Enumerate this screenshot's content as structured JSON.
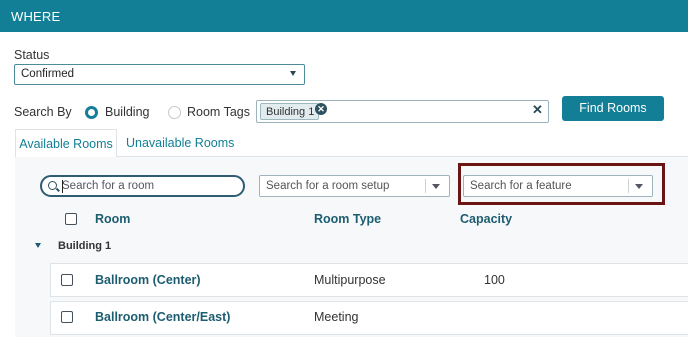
{
  "header": {
    "title": "WHERE"
  },
  "status": {
    "label": "Status",
    "value": "Confirmed"
  },
  "search_by": {
    "label": "Search By",
    "options": [
      "Building",
      "Room Tags"
    ],
    "selected": "Building",
    "tags": [
      "Building 1"
    ]
  },
  "find_button": {
    "label": "Find Rooms"
  },
  "tabs": [
    {
      "label": "Available Rooms",
      "active": true
    },
    {
      "label": "Unavailable Rooms",
      "active": false
    }
  ],
  "filters": {
    "room_search_placeholder": "Search for a room",
    "room_setup_placeholder": "Search for a room setup",
    "feature_placeholder": "Search for a feature"
  },
  "table": {
    "columns": [
      "Room",
      "Room Type",
      "Capacity"
    ],
    "group": {
      "label": "Building 1"
    },
    "rows": [
      {
        "room": "Ballroom (Center)",
        "type": "Multipurpose",
        "capacity": "100"
      },
      {
        "room": "Ballroom (Center/East)",
        "type": "Meeting",
        "capacity": ""
      }
    ]
  },
  "colors": {
    "primary": "#127f96",
    "highlight_border": "#6b1414"
  }
}
